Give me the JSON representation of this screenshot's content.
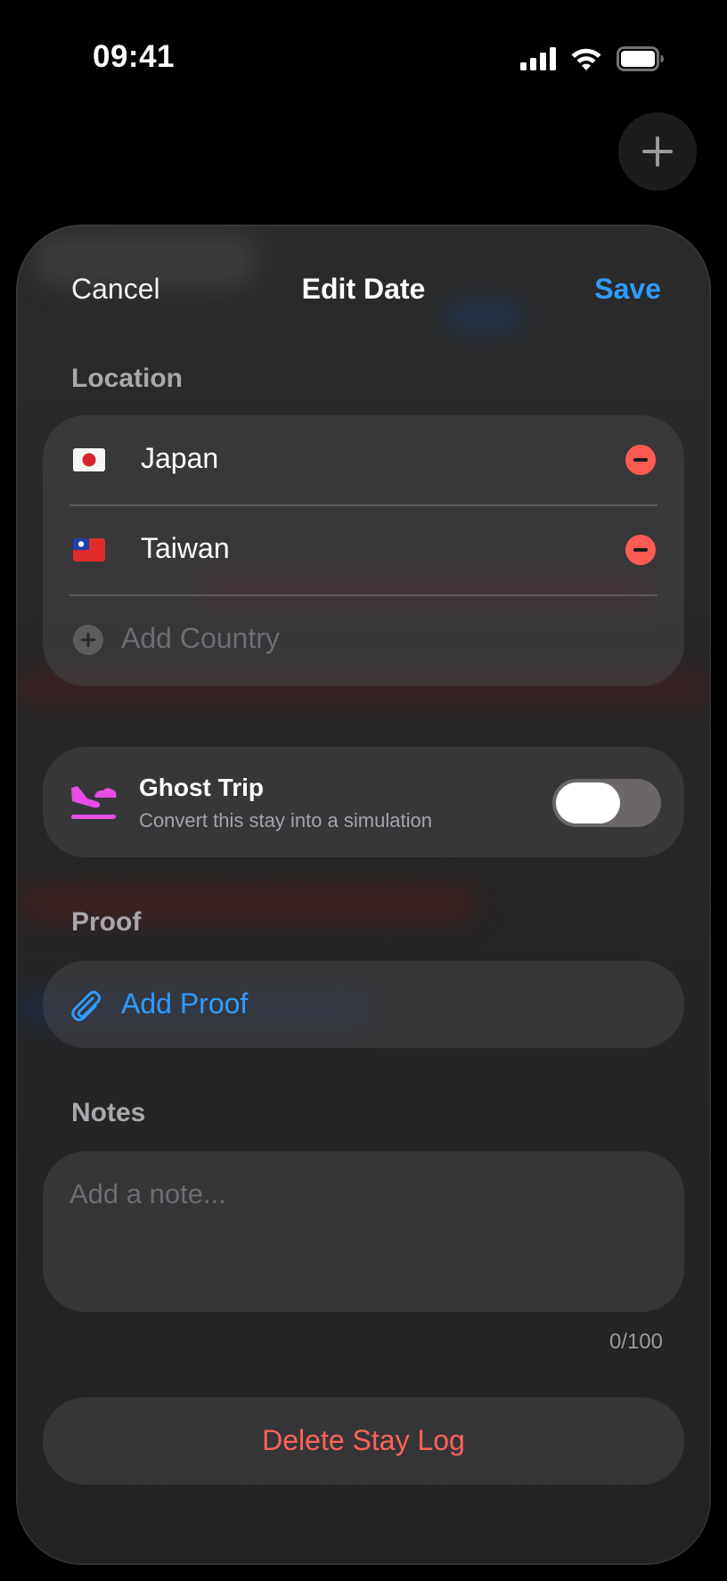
{
  "status_bar": {
    "time": "09:41"
  },
  "nav": {
    "cancel_label": "Cancel",
    "title": "Edit Date",
    "save_label": "Save"
  },
  "location": {
    "header": "Location",
    "countries": [
      {
        "name": "Japan",
        "flag": "japan-flag"
      },
      {
        "name": "Taiwan",
        "flag": "taiwan-flag"
      }
    ],
    "add_label": "Add Country"
  },
  "ghost_trip": {
    "title": "Ghost Trip",
    "subtitle": "Convert this stay into a simulation",
    "enabled": false,
    "icon": "plane-landing-icon"
  },
  "proof": {
    "header": "Proof",
    "add_label": "Add Proof",
    "icon": "paperclip-icon"
  },
  "notes": {
    "header": "Notes",
    "placeholder": "Add a note...",
    "counter": "0/100"
  },
  "delete": {
    "label": "Delete Stay Log"
  },
  "colors": {
    "accent_blue": "#2f9bff",
    "destructive_red": "#ff6259",
    "ghost_magenta": "#e84de8"
  }
}
